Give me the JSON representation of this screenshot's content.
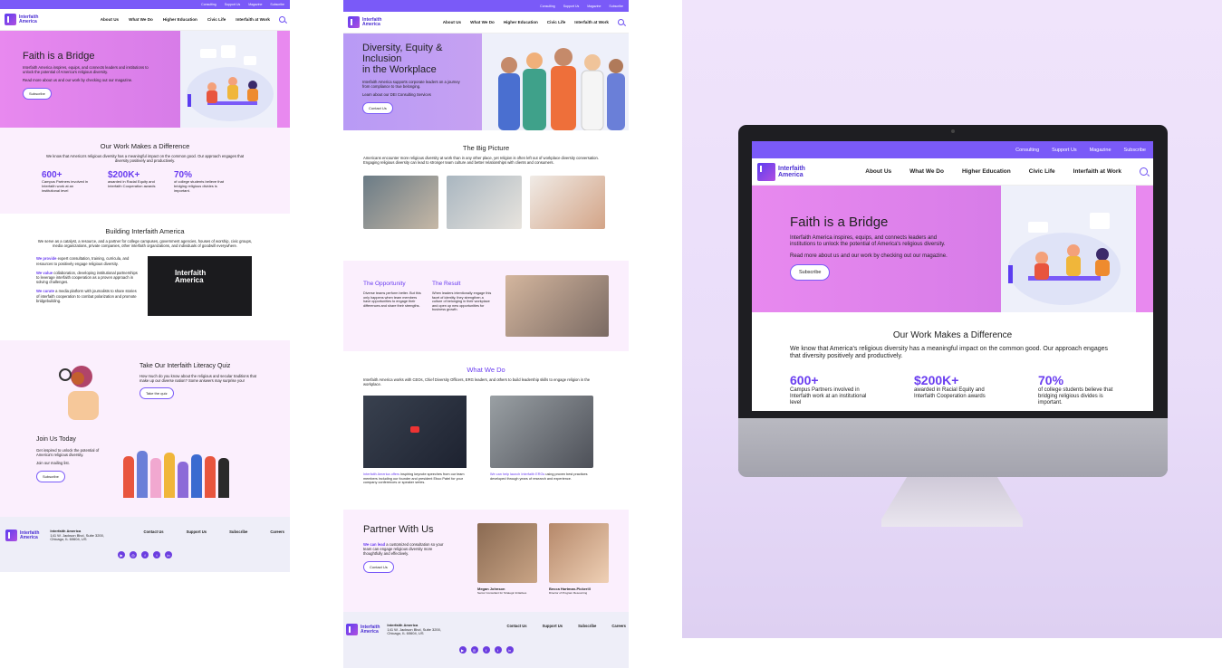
{
  "brand": {
    "logo_text": "Interfaith\nAmerica",
    "accent": "#7a5af8",
    "pink": "#e889ef"
  },
  "topbar_p1": [
    "Consulting",
    "Support Us",
    "Magazine",
    "Subscribe"
  ],
  "topbar_p2": [
    "Consulting",
    "Support Us",
    "Magazine",
    "Subscribe"
  ],
  "nav_p1": [
    "About Us",
    "What We Do",
    "Higher Education",
    "Civic Life",
    "Interfaith at Work"
  ],
  "nav_p2": [
    "About Us",
    "What We Do",
    "Higher Education",
    "Civic Life",
    "Interfaith at Work"
  ],
  "home": {
    "hero_title": "Faith is a Bridge",
    "hero_text": "Interfaith America inspires, equips, and connects leaders and institutions to unlock the potential of America's religious diversity.",
    "hero_text2": "Read more about us and our work by checking out our magazine.",
    "hero_btn": "Subscribe",
    "diff_title": "Our Work Makes a Difference",
    "diff_text": "We know that America's religious diversity has a meaningful impact on the common good. Our approach engages that diversity positively and productively.",
    "stats": [
      {
        "num": "600+",
        "desc": "Campus Partners involved in Interfaith work at an institutional level"
      },
      {
        "num": "$200K+",
        "desc": "awarded in Racial Equity and Interfaith Cooperation awards"
      },
      {
        "num": "70%",
        "desc": "of college students believe that bridging religious divides is important."
      }
    ],
    "build_title": "Building Interfaith America",
    "build_text": "We serve as a catalyst, a resource, and a partner for college campuses, government agencies, houses of worship, civic groups, media organizations, private companies, other interfaith organizations, and individuals of goodwill everywhere.",
    "provide_k": "We provide",
    "provide_t": " expert consultation, training, curricula, and resources to positively engage religious diversity.",
    "value_k": "We value",
    "value_t": " collaboration, developing institutional partnerships to leverage interfaith cooperation as a proven approach in solving challenges.",
    "curate_k": "We curate",
    "curate_t": " a media platform with journalists to share stories of interfaith cooperation to combat polarization and promote bridgebuilding.",
    "video_title": "Interfaith\nAmerica",
    "quiz_title": "Take Our Interfaith Literacy Quiz",
    "quiz_text": "How much do you know about the religious and secular traditions that make up our diverse nation? Some answers may surprise you!",
    "quiz_btn": "Take the quiz",
    "join_title": "Join Us Today",
    "join_text": "Get inspired to unlock the potential of America's religious diversity.",
    "join_text2": "Join our mailing list.",
    "join_btn": "Subscribe"
  },
  "footer": {
    "org": "Interfaith America",
    "addr1": "141 W. Jackson Blvd, Suite 3200,",
    "addr2": "Chicago, IL 60604, US",
    "links": [
      "Contact Us",
      "Support Us",
      "Subscribe",
      "Careers"
    ]
  },
  "work": {
    "hero_title": "Diversity, Equity &\nInclusion\nin the Workplace",
    "hero_text": "Interfaith America supports corporate leaders on a journey from compliance to true belonging.",
    "hero_text2": "Learn about our DEI Consulting Services",
    "hero_btn": "Contact Us",
    "big_title": "The Big Picture",
    "big_text": "Americans encounter more religious diversity at work than in any other place, yet religion is often left out of workplace diversity conversation. Engaging religious diversity can lead to stronger team culture and better relationships with clients and consumers.",
    "opp_title": "The Opportunity",
    "opp_text": "Diverse teams perform better. But this only happens when team members have opportunities to engage their differences and share their strengths.",
    "res_title": "The Result",
    "res_text": "When leaders intentionally engage this facet of identity, they strengthen a culture of belonging in their workplace and open up new opportunities for business growth.",
    "do_title": "What We Do",
    "do_text": "Interfaith America works with CEOs, Chief Diversity Officers, ERG leaders, and others to build leadership skills to engage religion in the workplace.",
    "offers_k": "Interfaith America offers",
    "offers_t": " inspiring keynote speeches from our team members including our founder and president Eboo Patel for your company conferences or speaker series.",
    "ergs_k": "We can help launch Interfaith ERGs",
    "ergs_t": " using proven best practices developed through years of research and experience.",
    "partner_title": "Partner With Us",
    "partner_k": "We can lead",
    "partner_t": " a customized consultation so your team can engage religious diversity more thoughtfully and effectively.",
    "partner_btn": "Contact Us",
    "person1": "Megan Johnson",
    "role1": "Senior Consultant for Strategic Initiatives",
    "person2": "Becca Hartman-Pickerill",
    "role2": "Director of Program Resourcing"
  }
}
